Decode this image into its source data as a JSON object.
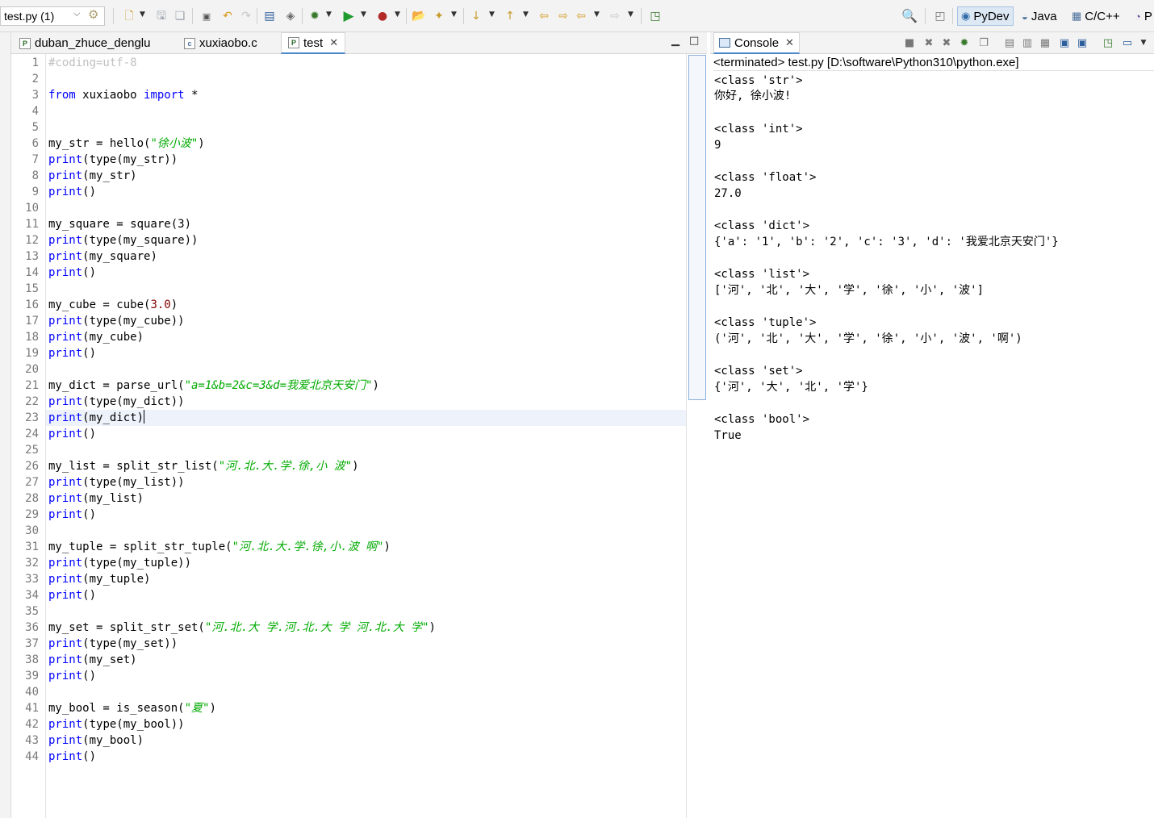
{
  "toolbar": {
    "run_config": "test.py (1)",
    "perspectives": [
      "PyDev",
      "Java",
      "C/C++",
      "P"
    ]
  },
  "editor": {
    "tabs": [
      {
        "label": "duban_zhuce_denglu"
      },
      {
        "label": "xuxiaobo.c"
      },
      {
        "label": "test"
      }
    ],
    "line_numbers": [
      "1",
      "2",
      "3",
      "4",
      "5",
      "6",
      "7",
      "8",
      "9",
      "10",
      "11",
      "12",
      "13",
      "14",
      "15",
      "16",
      "17",
      "18",
      "19",
      "20",
      "21",
      "22",
      "23",
      "24",
      "25",
      "26",
      "27",
      "28",
      "29",
      "30",
      "31",
      "32",
      "33",
      "34",
      "35",
      "36",
      "37",
      "38",
      "39",
      "40",
      "41",
      "42",
      "43",
      "44"
    ],
    "code": {
      "l1": "#coding=utf-8",
      "l3a": "from",
      "l3b": " xuxiaobo ",
      "l3c": "import",
      "l3d": " *",
      "l6a": "my_str = hello(",
      "l6b": "\"徐小波\"",
      "l6c": ")",
      "l7a": "print",
      "l7b": "(type(my_str))",
      "l8a": "print",
      "l8b": "(my_str)",
      "l9a": "print",
      "l9b": "()",
      "l11": "my_square = square(3)",
      "l12a": "print",
      "l12b": "(type(my_square))",
      "l13a": "print",
      "l13b": "(my_square)",
      "l14a": "print",
      "l14b": "()",
      "l16a": "my_cube = cube(",
      "l16b": "3.0",
      "l16c": ")",
      "l17a": "print",
      "l17b": "(type(my_cube))",
      "l18a": "print",
      "l18b": "(my_cube)",
      "l19a": "print",
      "l19b": "()",
      "l21a": "my_dict = parse_url(",
      "l21b": "\"a=1&b=2&c=3&d=我爱北京天安门\"",
      "l21c": ")",
      "l22a": "print",
      "l22b": "(type(my_dict))",
      "l23a": "print",
      "l23b": "(my_dict)",
      "l24a": "print",
      "l24b": "()",
      "l26a": "my_list = split_str_list(",
      "l26b": "\"河.北.大.学.徐,小 波\"",
      "l26c": ")",
      "l27a": "print",
      "l27b": "(type(my_list))",
      "l28a": "print",
      "l28b": "(my_list)",
      "l29a": "print",
      "l29b": "()",
      "l31a": "my_tuple = split_str_tuple(",
      "l31b": "\"河.北.大.学.徐,小.波 啊\"",
      "l31c": ")",
      "l32a": "print",
      "l32b": "(type(my_tuple))",
      "l33a": "print",
      "l33b": "(my_tuple)",
      "l34a": "print",
      "l34b": "()",
      "l36a": "my_set = split_str_set(",
      "l36b": "\"河.北.大 学.河.北.大 学 河.北.大 学\"",
      "l36c": ")",
      "l37a": "print",
      "l37b": "(type(my_set))",
      "l38a": "print",
      "l38b": "(my_set)",
      "l39a": "print",
      "l39b": "()",
      "l41a": "my_bool = is_season(",
      "l41b": "\"夏\"",
      "l41c": ")",
      "l42a": "print",
      "l42b": "(type(my_bool))",
      "l43a": "print",
      "l43b": "(my_bool)",
      "l44a": "print",
      "l44b": "()"
    }
  },
  "console": {
    "tab_label": "Console",
    "status": "<terminated> test.py [D:\\software\\Python310\\python.exe]",
    "output": [
      "<class 'str'>",
      "你好, 徐小波!",
      "",
      "<class 'int'>",
      "9",
      "",
      "<class 'float'>",
      "27.0",
      "",
      "<class 'dict'>",
      "{'a': '1', 'b': '2', 'c': '3', 'd': '我爱北京天安门'}",
      "",
      "<class 'list'>",
      "['河', '北', '大', '学', '徐', '小', '波']",
      "",
      "<class 'tuple'>",
      "('河', '北', '大', '学', '徐', '小', '波', '啊')",
      "",
      "<class 'set'>",
      "{'河', '大', '北', '学'}",
      "",
      "<class 'bool'>",
      "True"
    ]
  },
  "colors": {
    "keyword": "#0000ff",
    "string": "#00aa00",
    "comment": "#c0c0c0",
    "number": "#800000",
    "active_tab_underline": "#4f88c9"
  }
}
